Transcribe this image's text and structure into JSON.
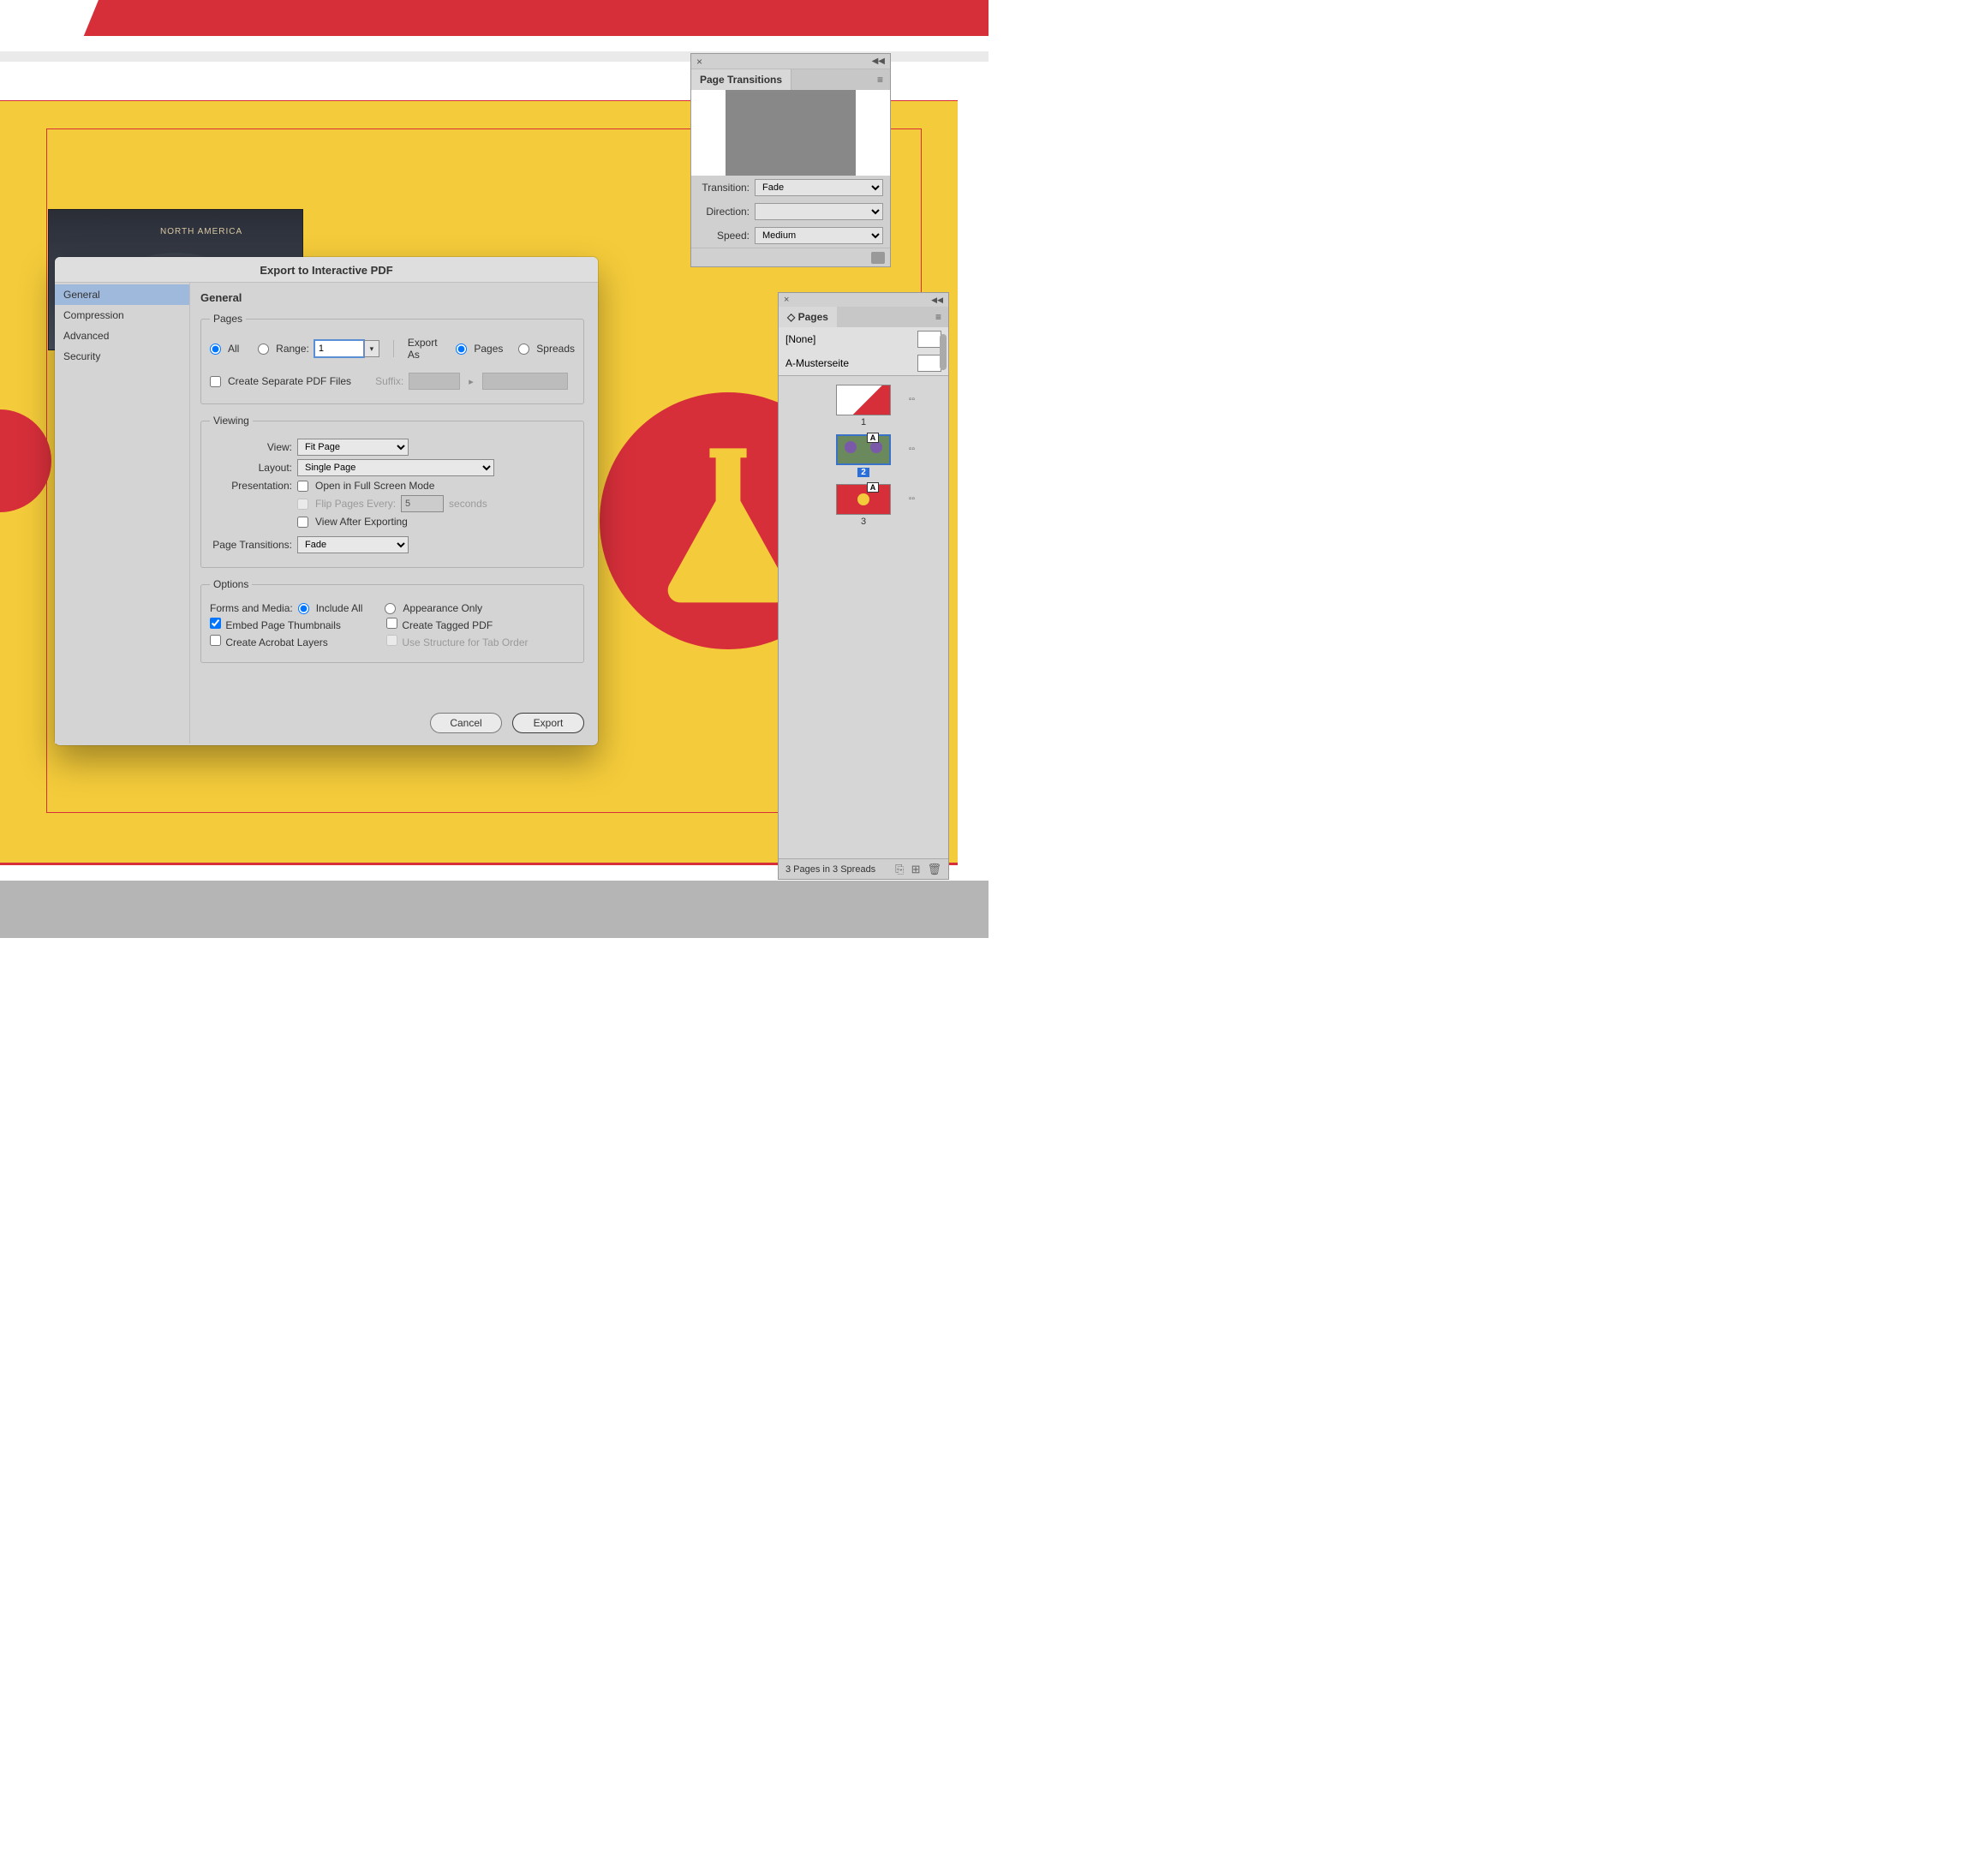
{
  "canvas": {
    "na_label": "NORTH\nAMERICA"
  },
  "pt_panel": {
    "title": "Page Transitions",
    "labels": {
      "transition": "Transition:",
      "direction": "Direction:",
      "speed": "Speed:"
    },
    "transition": "Fade",
    "direction": "",
    "speed": "Medium"
  },
  "pages_panel": {
    "title": "Pages",
    "masters": [
      "[None]",
      "A-Musterseite"
    ],
    "thumbs": [
      {
        "label": "1",
        "master_badge": ""
      },
      {
        "label": "2",
        "master_badge": "A",
        "selected": true
      },
      {
        "label": "3",
        "master_badge": "A"
      }
    ],
    "footer": "3 Pages in 3 Spreads"
  },
  "dialog": {
    "title": "Export to Interactive PDF",
    "side": [
      "General",
      "Compression",
      "Advanced",
      "Security"
    ],
    "active_side": "General",
    "heading": "General",
    "pages": {
      "legend": "Pages",
      "all": "All",
      "range": "Range:",
      "range_value": "1",
      "export_as": "Export As",
      "pages_label": "Pages",
      "spreads": "Spreads",
      "separate": "Create Separate PDF Files",
      "suffix": "Suffix:"
    },
    "viewing": {
      "legend": "Viewing",
      "view": "View:",
      "view_value": "Fit Page",
      "layout": "Layout:",
      "layout_value": "Single Page",
      "presentation": "Presentation:",
      "open_full": "Open in Full Screen Mode",
      "flip": "Flip Pages Every:",
      "flip_value": "5",
      "seconds": "seconds",
      "view_after": "View After Exporting",
      "transitions": "Page Transitions:",
      "transitions_value": "Fade"
    },
    "options": {
      "legend": "Options",
      "forms": "Forms and Media:",
      "include_all": "Include All",
      "appearance": "Appearance Only",
      "embed": "Embed Page Thumbnails",
      "tagged": "Create Tagged PDF",
      "layers": "Create Acrobat Layers",
      "structure": "Use Structure for Tab Order"
    },
    "buttons": {
      "cancel": "Cancel",
      "export": "Export"
    }
  }
}
